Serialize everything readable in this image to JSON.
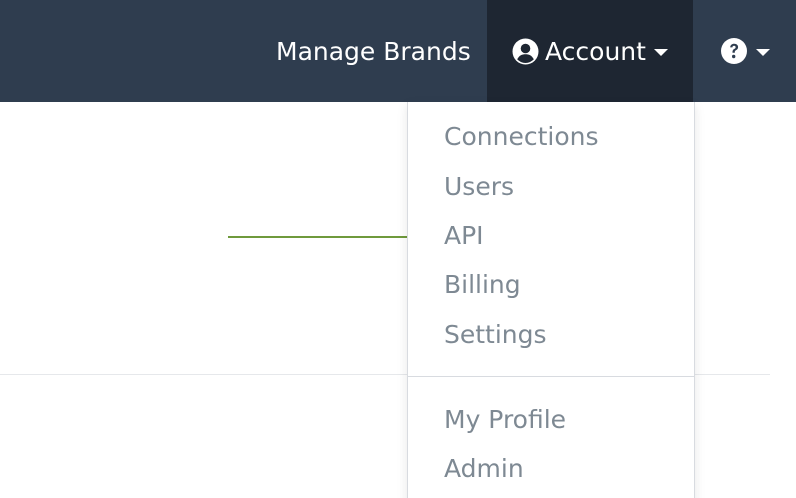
{
  "navbar": {
    "manage_brands": "Manage Brands",
    "account": "Account",
    "account_icon": "user-circle-icon",
    "help_icon": "question-circle-icon"
  },
  "dropdown": {
    "items": [
      {
        "label": "Connections"
      },
      {
        "label": "Users"
      },
      {
        "label": "API"
      },
      {
        "label": "Billing"
      },
      {
        "label": "Settings"
      }
    ],
    "secondary_items": [
      {
        "label": "My Profile"
      },
      {
        "label": "Admin"
      }
    ]
  },
  "colors": {
    "navbar_bg": "#2f3d4f",
    "active_nav_bg": "#1e2632",
    "menu_text": "#7e8993",
    "arrow": "#6f9a3c"
  }
}
